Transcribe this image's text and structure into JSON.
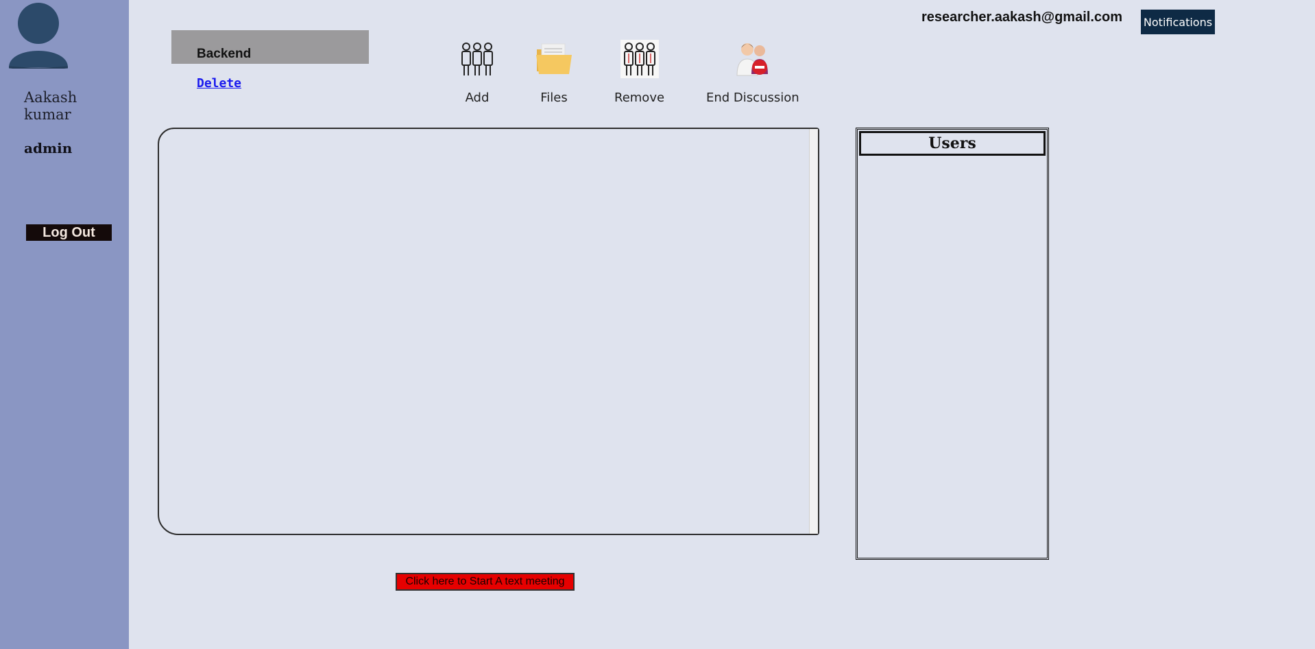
{
  "sidebar": {
    "user_name": "Aakash kumar",
    "user_role": "admin",
    "logout_label": "Log Out"
  },
  "group": {
    "title": "Backend",
    "delete_label": "Delete"
  },
  "toolbar": {
    "items": [
      {
        "label": "Add",
        "icon": "people-group-icon"
      },
      {
        "label": "Files",
        "icon": "folder-icon"
      },
      {
        "label": "Remove",
        "icon": "people-group-remove-icon"
      },
      {
        "label": "End Discussion",
        "icon": "end-discussion-icon"
      }
    ]
  },
  "header": {
    "email": "researcher.aakash@gmail.com",
    "notifications_label": "Notifications"
  },
  "users_panel": {
    "title": "Users"
  },
  "meeting": {
    "start_label": "Click here to Start A text meeting"
  },
  "colors": {
    "background": "#dfe3ee",
    "sidebar": "#8a96c3",
    "notifications": "#0e2a45",
    "start_button": "#e60000"
  }
}
